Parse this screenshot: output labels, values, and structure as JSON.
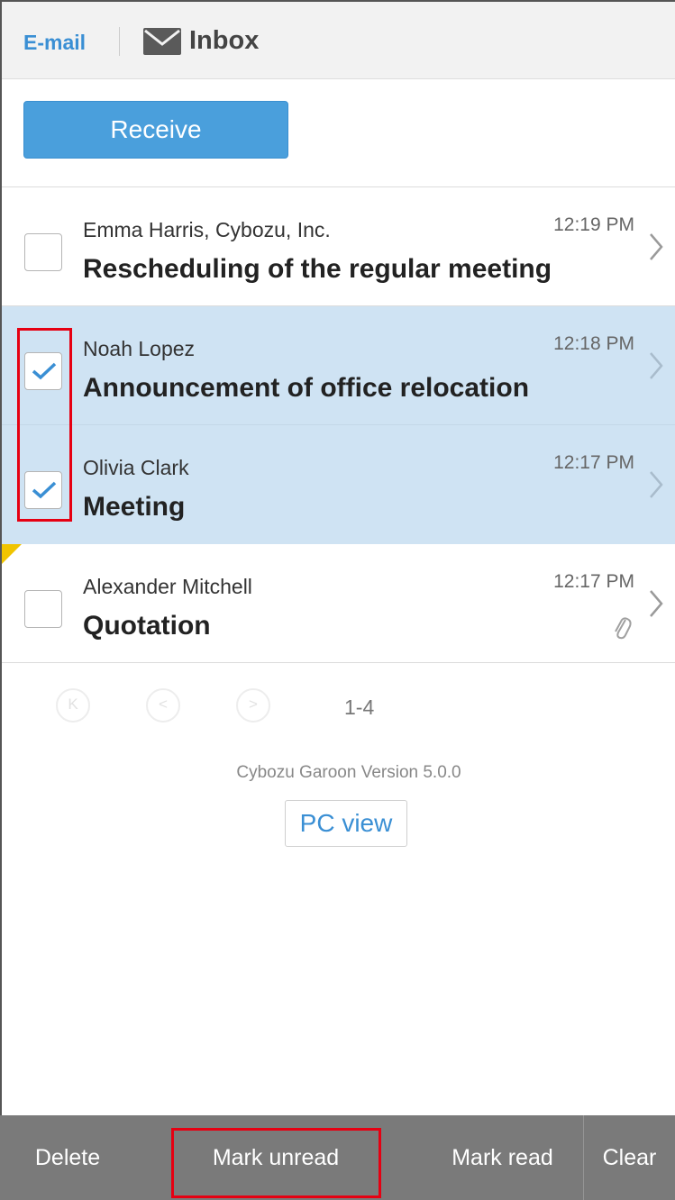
{
  "header": {
    "app_link": "E-mail",
    "folder_icon": "envelope-icon",
    "folder_title": "Inbox"
  },
  "receive_label": "Receive",
  "mails": [
    {
      "sender": "Emma Harris, Cybozu, Inc.",
      "time": "12:19 PM",
      "subject": "Rescheduling of the regular meeting",
      "checked": false,
      "attachment": false,
      "flagged": false
    },
    {
      "sender": "Noah Lopez",
      "time": "12:18 PM",
      "subject": "Announcement of office relocation",
      "checked": true,
      "attachment": false,
      "flagged": false
    },
    {
      "sender": "Olivia Clark",
      "time": "12:17 PM",
      "subject": "Meeting",
      "checked": true,
      "attachment": false,
      "flagged": false
    },
    {
      "sender": "Alexander Mitchell",
      "time": "12:17 PM",
      "subject": "Quotation",
      "checked": false,
      "attachment": true,
      "flagged": true
    }
  ],
  "pager": {
    "range": "1-4",
    "first_icon": "first-page-icon",
    "prev_icon": "prev-page-icon",
    "next_icon": "next-page-icon"
  },
  "footer": {
    "version": "Cybozu Garoon Version 5.0.0",
    "pc_view_label": "PC view"
  },
  "toolbar": {
    "delete_label": "Delete",
    "mark_unread_label": "Mark unread",
    "mark_read_label": "Mark read",
    "clear_label": "Clear"
  },
  "colors": {
    "accent": "#3a8fd4",
    "selected_row": "#cfe3f3",
    "toolbar_bg": "#7a7a7a",
    "highlight": "#e60012"
  }
}
